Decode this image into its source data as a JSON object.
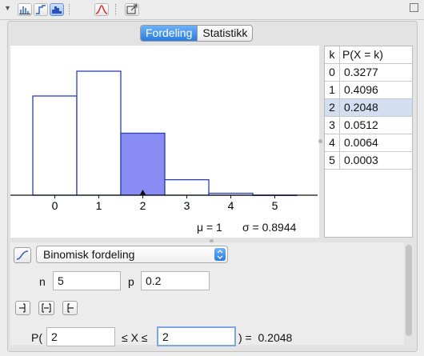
{
  "toolbar": {
    "buttons": [
      {
        "name": "bar-chart-view-icon",
        "selected": false
      },
      {
        "name": "step-chart-view-icon",
        "selected": false
      },
      {
        "name": "histogram-view-icon",
        "selected": true
      },
      {
        "name": "normal-overlay-icon",
        "selected": false
      },
      {
        "name": "export-icon",
        "selected": false
      }
    ]
  },
  "tabs": [
    {
      "label": "Fordeling",
      "active": true
    },
    {
      "label": "Statistikk",
      "active": false
    }
  ],
  "chart_data": {
    "type": "bar",
    "categories": [
      "0",
      "1",
      "2",
      "3",
      "4",
      "5"
    ],
    "values": [
      0.3277,
      0.4096,
      0.2048,
      0.0512,
      0.0064,
      0.0003
    ],
    "highlighted": [
      "2"
    ],
    "colors": {
      "bar_edge": "#2b3fb0",
      "highlight_fill": "#8a8cf5",
      "axis": "#111111"
    },
    "mean_label": "μ = 1",
    "sd_label": "σ = 0.8944"
  },
  "table": {
    "headers": [
      "k",
      "P(X = k)"
    ],
    "rows": [
      [
        "0",
        "0.3277"
      ],
      [
        "1",
        "0.4096"
      ],
      [
        "2",
        "0.2048"
      ],
      [
        "3",
        "0.0512"
      ],
      [
        "4",
        "0.0064"
      ],
      [
        "5",
        "0.0003"
      ]
    ],
    "selected_row": 2
  },
  "controls": {
    "distribution": "Binomisk fordeling",
    "n_label": "n",
    "n_value": "5",
    "p_label": "p",
    "p_value": "0.2",
    "prob_prefix": "P(",
    "lower_value": "2",
    "middle": "≤ X ≤",
    "upper_value": "2",
    "result": ") =  0.2048"
  }
}
